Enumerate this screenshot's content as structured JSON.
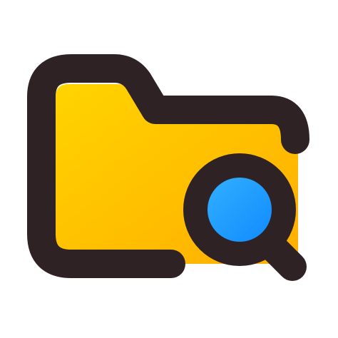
{
  "icon": {
    "name": "folder-search-icon",
    "colors": {
      "outline": "#2f2224",
      "folder_fill_light": "#ffd400",
      "folder_fill_dark": "#ffae00",
      "lens_fill_light": "#38b6ff",
      "lens_fill_dark": "#0a84ff"
    }
  }
}
